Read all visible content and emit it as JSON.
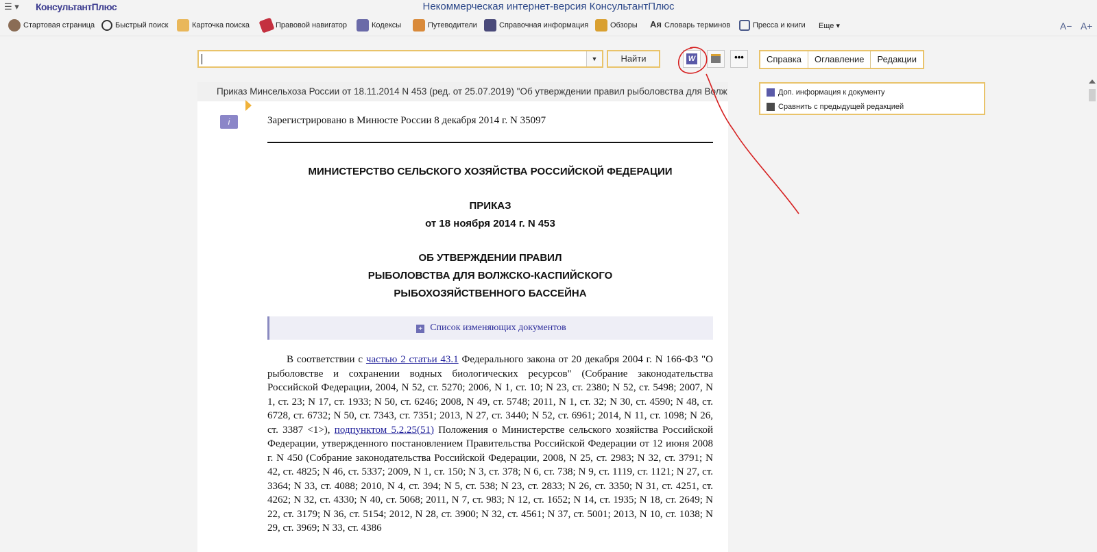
{
  "app": {
    "logo": "КонсультантПлюс",
    "title": "Некоммерческая интернет-версия КонсультантПлюс",
    "menu_glyph": "☰ ▾"
  },
  "toolbar": {
    "items": [
      {
        "label": "Стартовая страница",
        "icon": "home-icon"
      },
      {
        "label": "Быстрый поиск",
        "icon": "search-icon"
      },
      {
        "label": "Карточка поиска",
        "icon": "search-card-icon"
      },
      {
        "label": "Правовой навигатор",
        "icon": "navigator-icon"
      },
      {
        "label": "Кодексы",
        "icon": "codex-icon"
      },
      {
        "label": "Путеводители",
        "icon": "guide-icon"
      },
      {
        "label": "Справочная информация",
        "icon": "reference-icon"
      },
      {
        "label": "Обзоры",
        "icon": "review-icon"
      },
      {
        "label": "Словарь терминов",
        "icon": "dictionary-icon"
      },
      {
        "label": "Пресса и книги",
        "icon": "press-icon"
      },
      {
        "label": "Еще ▾",
        "icon": ""
      }
    ],
    "font_decrease": "A−",
    "font_increase": "A+"
  },
  "search": {
    "value": "",
    "find_label": "Найти"
  },
  "doc_tabs": [
    "Справка",
    "Оглавление",
    "Редакции"
  ],
  "side_panel": {
    "items": [
      "Доп. информация к документу",
      "Сравнить с предыдущей редакцией"
    ]
  },
  "document": {
    "header": "Приказ Минсельхоза России от 18.11.2014 N 453 (ред. от 25.07.2019) \"Об утверждении правил рыболовства для Волж",
    "info_glyph": "i",
    "registration": "Зарегистрировано в Минюсте России 8 декабря 2014 г. N 35097",
    "ministry": "МИНИСТЕРСТВО СЕЛЬСКОГО ХОЗЯЙСТВА РОССИЙСКОЙ ФЕДЕРАЦИИ",
    "order_title": "ПРИКАЗ",
    "order_date": "от 18 ноября 2014 г. N 453",
    "subject_line1": "ОБ УТВЕРЖДЕНИИ ПРАВИЛ",
    "subject_line2": "РЫБОЛОВСТВА ДЛЯ ВОЛЖСКО-КАСПИЙСКОГО",
    "subject_line3": "РЫБОХОЗЯЙСТВЕННОГО БАССЕЙНА",
    "changes_label": "Список изменяющих документов",
    "para_part1": "В соответствии с ",
    "link1": "частью 2 статьи 43.1",
    "para_part2": " Федерального закона от 20 декабря 2004 г. N 166-ФЗ \"О рыболовстве и сохранении водных биологических ресурсов\" (Собрание законодательства Российской Федерации, 2004, N 52, ст. 5270; 2006, N 1, ст. 10; N 23, ст. 2380; N 52, ст. 5498; 2007, N 1, ст. 23; N 17, ст. 1933; N 50, ст. 6246; 2008, N 49, ст. 5748; 2011, N 1, ст. 32; N 30, ст. 4590; N 48, ст. 6728, ст. 6732; N 50, ст. 7343, ст. 7351; 2013, N 27, ст. 3440; N 52, ст. 6961; 2014, N 11, ст. 1098; N 26, ст. 3387 <1>), ",
    "link2": "подпунктом 5.2.25(51)",
    "para_part3": " Положения о Министерстве сельского хозяйства Российской Федерации, утвержденного постановлением Правительства Российской Федерации от 12 июня 2008 г. N 450 (Собрание законодательства Российской Федерации, 2008, N 25, ст. 2983; N 32, ст. 3791; N 42, ст. 4825; N 46, ст. 5337; 2009, N 1, ст. 150; N 3, ст. 378; N 6, ст. 738; N 9, ст. 1119, ст. 1121; N 27, ст. 3364; N 33, ст. 4088; 2010, N 4, ст. 394; N 5, ст. 538; N 23, ст. 2833; N 26, ст. 3350; N 31, ст. 4251, ст. 4262; N 32, ст. 4330; N 40, ст. 5068; 2011, N 7, ст. 983; N 12, ст. 1652; N 14, ст. 1935; N 18, ст. 2649; N 22, ст. 3179; N 36, ст. 5154; 2012, N 28, ст. 3900; N 32, ст. 4561; N 37, ст. 5001; 2013, N 10, ст. 1038; N 29, ст. 3969; N 33, ст. 4386"
  },
  "colors": {
    "accent_border": "#e9c36a",
    "link": "#1f1f9a",
    "annotation": "#d62020"
  }
}
